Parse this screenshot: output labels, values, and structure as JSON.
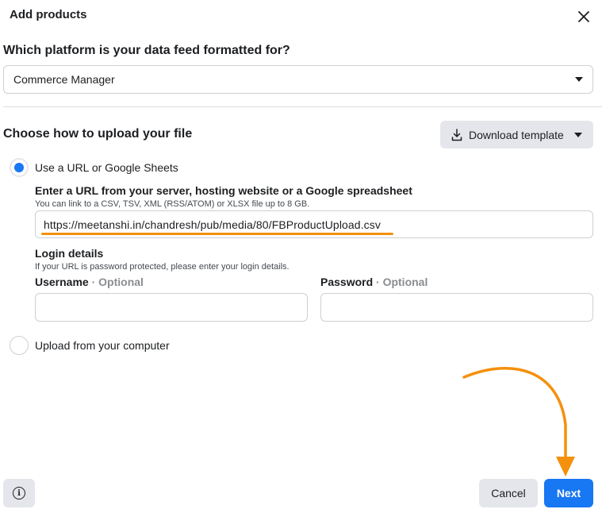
{
  "dialog": {
    "title": "Add products",
    "close_icon": "close-icon"
  },
  "platform": {
    "question": "Which platform is your data feed formatted for?",
    "selected": "Commerce Manager"
  },
  "upload": {
    "heading": "Choose how to upload your file",
    "download_template_label": "Download template",
    "option_url": {
      "label": "Use a URL or Google Sheets",
      "checked": true,
      "field_label": "Enter a URL from your server, hosting website or a Google spreadsheet",
      "field_hint": "You can link to a CSV, TSV, XML (RSS/ATOM) or XLSX file up to 8 GB.",
      "url_value": "https://meetanshi.in/chandresh/pub/media/80/FBProductUpload.csv"
    },
    "login": {
      "heading": "Login details",
      "hint": "If your URL is password protected, please enter your login details.",
      "username_label": "Username",
      "password_label": "Password",
      "optional_label": "· Optional",
      "username_value": "",
      "password_value": ""
    },
    "option_computer": {
      "label": "Upload from your computer",
      "checked": false
    }
  },
  "footer": {
    "cancel_label": "Cancel",
    "next_label": "Next"
  },
  "colors": {
    "primary": "#1877f2",
    "annotation": "#f4900c",
    "secondary_button": "#e4e6eb"
  }
}
